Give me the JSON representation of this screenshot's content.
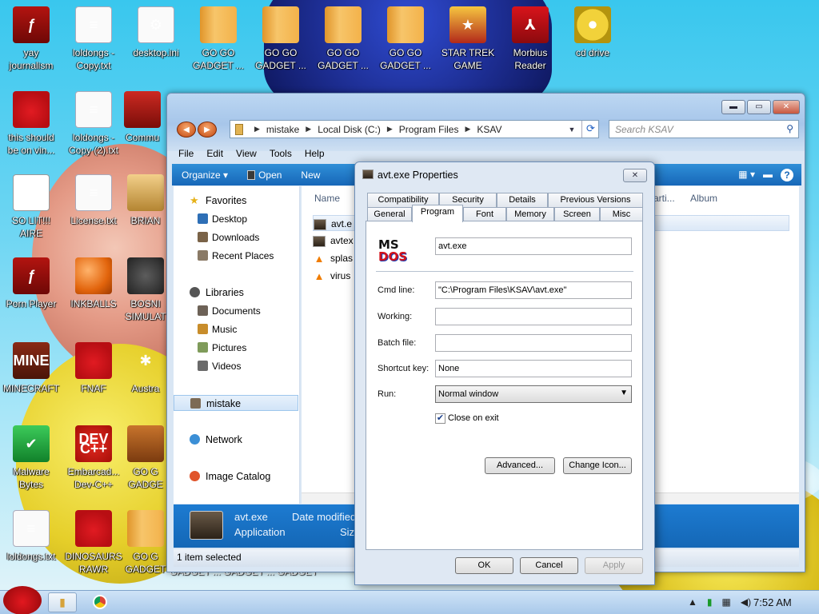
{
  "desktop": {
    "icons": [
      {
        "label": "yay\njournalism"
      },
      {
        "label": "loldongs -\nCopy.txt"
      },
      {
        "label": "desktop.ini"
      },
      {
        "label": "GO GO\nGADGET ..."
      },
      {
        "label": "GO GO\nGADGET ..."
      },
      {
        "label": "GO GO\nGADGET ..."
      },
      {
        "label": "GO GO\nGADGET ..."
      },
      {
        "label": "STAR TREK\nGAME"
      },
      {
        "label": "Morbius\nReader"
      },
      {
        "label": "cd drive"
      },
      {
        "label": "this should\nbe on vin..."
      },
      {
        "label": "loldongs -\nCopy (2).txt"
      },
      {
        "label": "Commu"
      },
      {
        "label": "SO LIT!!!\nAIRE"
      },
      {
        "label": "License.txt"
      },
      {
        "label": "BRIAN"
      },
      {
        "label": "Porn Player"
      },
      {
        "label": "INKBALLS"
      },
      {
        "label": "BOSNI\nSIMULAT"
      },
      {
        "label": "MINECRAFT"
      },
      {
        "label": "FNAF"
      },
      {
        "label": "Austra"
      },
      {
        "label": "Malware\nBytes"
      },
      {
        "label": "Embarcad...\nDev-C++"
      },
      {
        "label": "GO G\nGADGE"
      },
      {
        "label": "loldongs.txt"
      },
      {
        "label": "DINOSAURS\nRAWR"
      },
      {
        "label": "GO G\nGADGET"
      }
    ],
    "under_window_text": "GADGET ... GADGET ... GADGET"
  },
  "explorer": {
    "address": [
      "mistake",
      "Local Disk (C:)",
      "Program Files",
      "KSAV"
    ],
    "search_placeholder": "Search KSAV",
    "menu": [
      "File",
      "Edit",
      "View",
      "Tools",
      "Help"
    ],
    "commands": [
      "Organize ▾",
      "Open",
      "New"
    ],
    "nav": {
      "favorites": "Favorites",
      "desktop": "Desktop",
      "downloads": "Downloads",
      "recent": "Recent Places",
      "libraries": "Libraries",
      "documents": "Documents",
      "music": "Music",
      "pictures": "Pictures",
      "videos": "Videos",
      "mistake": "mistake",
      "network": "Network",
      "image_catalog": "Image Catalog"
    },
    "columns": {
      "name": "Name",
      "arti": "arti...",
      "album": "Album"
    },
    "files": [
      "avt.e",
      "avtex",
      "splas",
      "virus"
    ],
    "details": {
      "name": "avt.exe",
      "type": "Application",
      "date_label": "Date modified",
      "size_label": "Size"
    },
    "status": "1 item selected"
  },
  "props": {
    "title": "avt.exe Properties",
    "tabs_row1": [
      "Compatibility",
      "Security",
      "Details",
      "Previous Versions"
    ],
    "tabs_row2": [
      "General",
      "Program",
      "Font",
      "Memory",
      "Screen",
      "Misc"
    ],
    "program_name": "avt.exe",
    "msdos_logo": {
      "ms": "MS",
      "dos": "DOS"
    },
    "fields": {
      "cmd_line_label": "Cmd line:",
      "cmd_line_value": "\"C:\\Program Files\\KSAV\\avt.exe\"",
      "working_label": "Working:",
      "working_value": "",
      "batch_label": "Batch file:",
      "batch_value": "",
      "shortcut_label": "Shortcut key:",
      "shortcut_value": "None",
      "run_label": "Run:",
      "run_value": "Normal window"
    },
    "close_on_exit": {
      "label": "Close on exit",
      "checked": true
    },
    "buttons": {
      "advanced": "Advanced...",
      "change_icon": "Change Icon...",
      "ok": "OK",
      "cancel": "Cancel",
      "apply": "Apply"
    }
  },
  "taskbar": {
    "clock": "7:52 AM"
  }
}
